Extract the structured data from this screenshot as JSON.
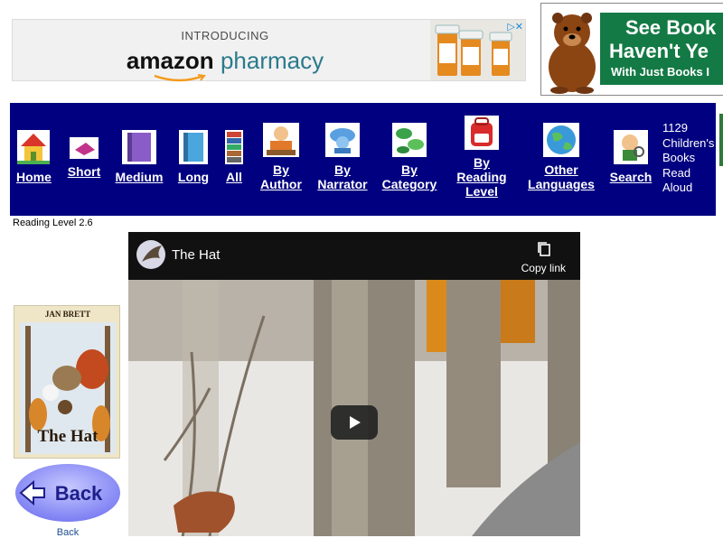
{
  "ads": {
    "amazon": {
      "intro": "INTRODUCING",
      "brand_amazon": "amazon",
      "brand_pharmacy": "pharmacy"
    },
    "books": {
      "line1": "See Book",
      "line2": "Haven't Ye",
      "line3": "With Just Books I"
    }
  },
  "nav": {
    "items": [
      {
        "label": "Home",
        "icon": "house-icon"
      },
      {
        "label": "Short",
        "icon": "small-book-icon"
      },
      {
        "label": "Medium",
        "icon": "medium-book-icon"
      },
      {
        "label": "Long",
        "icon": "long-book-icon"
      },
      {
        "label": "All",
        "icon": "book-stack-icon"
      },
      {
        "label": "By Author",
        "icon": "author-icon"
      },
      {
        "label": "By Narrator",
        "icon": "narrator-icon"
      },
      {
        "label": "By Category",
        "icon": "category-icon"
      },
      {
        "label": "By Reading Level",
        "icon": "backpack-icon"
      },
      {
        "label": "Other Languages",
        "icon": "globe-icon"
      },
      {
        "label": "Search",
        "icon": "search-icon"
      }
    ],
    "count_text": "1129 Children's Books Read Aloud"
  },
  "reading_level": "Reading Level 2.6",
  "book": {
    "cover_author": "JAN BRETT",
    "cover_title": "The Hat",
    "back_label": "Back",
    "back_caption": "Back"
  },
  "video": {
    "title": "The Hat",
    "copy_link": "Copy link"
  }
}
